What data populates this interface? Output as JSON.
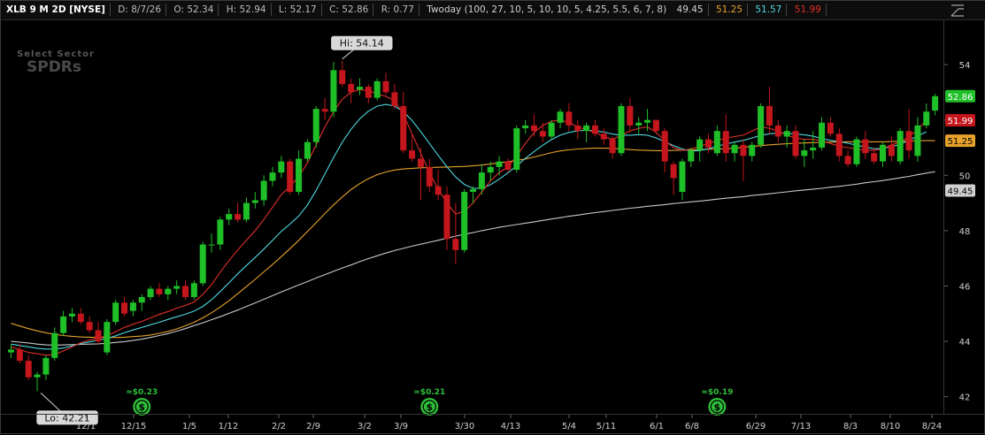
{
  "header": {
    "symbol": "XLB 9 M 2D [NYSE]",
    "date": "D: 8/7/26",
    "open": "O: 52.34",
    "high": "H: 52.94",
    "low": "L: 52.17",
    "close": "C: 52.86",
    "range": "R: 0.77",
    "study": "Twoday (100, 27, 10, 5, 10, 10, 5, 4.25, 5.5, 6, 7, 8)",
    "study_values": [
      {
        "text": "49.45",
        "color": "#d0d0d0"
      },
      {
        "text": "51.25",
        "color": "#e6a22b"
      },
      {
        "text": "51.57",
        "color": "#4fd6e0"
      },
      {
        "text": "51.99",
        "color": "#e0302a"
      }
    ]
  },
  "watermark": {
    "line1": "Select Sector",
    "line2": "SPDRs"
  },
  "colors": {
    "up": "#1fbf27",
    "down": "#c4161c",
    "ma_fast": "#e0302a",
    "ma_mid": "#4fd6e0",
    "ma_slow": "#e6a22b",
    "ma_long": "#c8c8c8",
    "dividend": "#2fbf3a"
  },
  "chart_data": {
    "type": "candlestick",
    "price_ticks": [
      42,
      44,
      46,
      48,
      50,
      52,
      54
    ],
    "date_ticks": [
      "12/1",
      "12/15",
      "1/5",
      "1/12",
      "2/2",
      "2/9",
      "3/2",
      "3/9",
      "3/30",
      "4/13",
      "5/4",
      "5/11",
      "6/1",
      "6/8",
      "6/29",
      "7/13",
      "8/3",
      "8/10",
      "8/24"
    ],
    "ylim": [
      41.35,
      55.6
    ],
    "price_labels": [
      {
        "text": "52.86",
        "value": 52.86,
        "bg": "#1fbf27",
        "fg": "#ffffff"
      },
      {
        "text": "51.99",
        "value": 51.99,
        "bg": "#c4161c",
        "fg": "#ffffff"
      },
      {
        "text": "51.25",
        "value": 51.25,
        "bg": "#e6a22b",
        "fg": "#000000"
      },
      {
        "text": "49.45",
        "value": 49.45,
        "bg": "#d0d0d0",
        "fg": "#000000"
      }
    ],
    "hi_label": "Hi: 54.14",
    "lo_label": "Lo: 42.21",
    "dividends": [
      {
        "text": "≈$0.23",
        "index": 15
      },
      {
        "text": "≈$0.21",
        "index": 48
      },
      {
        "text": "≈$0.19",
        "index": 81
      }
    ],
    "candles": [
      [
        43.6,
        43.9,
        43.4,
        43.7
      ],
      [
        43.7,
        43.9,
        43.2,
        43.3
      ],
      [
        43.3,
        43.5,
        42.6,
        42.7
      ],
      [
        42.7,
        42.9,
        42.2,
        42.8
      ],
      [
        42.8,
        43.5,
        42.6,
        43.4
      ],
      [
        43.4,
        44.5,
        43.3,
        44.3
      ],
      [
        44.3,
        45.1,
        44.2,
        44.9
      ],
      [
        44.9,
        45.2,
        44.7,
        45.0
      ],
      [
        45.0,
        45.2,
        44.6,
        44.7
      ],
      [
        44.7,
        44.9,
        44.3,
        44.4
      ],
      [
        44.4,
        44.7,
        43.9,
        44.0
      ],
      [
        43.6,
        44.8,
        43.5,
        44.7
      ],
      [
        44.7,
        45.5,
        44.6,
        45.4
      ],
      [
        45.4,
        45.6,
        44.9,
        45.0
      ],
      [
        45.1,
        45.5,
        44.9,
        45.4
      ],
      [
        45.4,
        45.7,
        45.1,
        45.6
      ],
      [
        45.6,
        46.0,
        45.5,
        45.9
      ],
      [
        45.9,
        46.1,
        45.6,
        45.7
      ],
      [
        45.7,
        46.0,
        45.5,
        45.9
      ],
      [
        45.9,
        46.2,
        45.7,
        46.0
      ],
      [
        46.0,
        46.2,
        45.5,
        45.6
      ],
      [
        45.6,
        46.2,
        45.5,
        46.1
      ],
      [
        46.1,
        47.6,
        46.0,
        47.5
      ],
      [
        47.5,
        47.9,
        47.2,
        47.5
      ],
      [
        47.5,
        48.5,
        47.3,
        48.4
      ],
      [
        48.4,
        48.8,
        48.2,
        48.6
      ],
      [
        48.6,
        49.0,
        48.3,
        48.4
      ],
      [
        48.4,
        49.2,
        48.3,
        49.0
      ],
      [
        49.0,
        49.4,
        48.8,
        49.1
      ],
      [
        49.1,
        50.0,
        48.9,
        49.8
      ],
      [
        49.8,
        50.3,
        49.6,
        50.1
      ],
      [
        50.1,
        50.7,
        49.9,
        50.5
      ],
      [
        50.5,
        50.6,
        49.3,
        49.4
      ],
      [
        49.4,
        50.9,
        49.3,
        50.6
      ],
      [
        50.6,
        51.3,
        50.5,
        51.2
      ],
      [
        51.2,
        52.5,
        51.0,
        52.4
      ],
      [
        52.4,
        52.8,
        52.0,
        52.3
      ],
      [
        52.3,
        54.1,
        52.1,
        53.8
      ],
      [
        53.8,
        54.14,
        53.2,
        53.3
      ],
      [
        53.3,
        53.5,
        52.6,
        53.0
      ],
      [
        53.1,
        53.5,
        52.9,
        53.2
      ],
      [
        53.2,
        53.3,
        52.6,
        52.8
      ],
      [
        52.8,
        53.5,
        52.7,
        53.4
      ],
      [
        53.4,
        53.7,
        52.9,
        53.0
      ],
      [
        53.0,
        53.3,
        52.4,
        52.5
      ],
      [
        52.5,
        53.0,
        50.8,
        50.9
      ],
      [
        50.9,
        51.5,
        50.5,
        50.6
      ],
      [
        50.6,
        51.0,
        49.1,
        50.3
      ],
      [
        50.3,
        50.6,
        49.4,
        49.6
      ],
      [
        49.6,
        50.2,
        49.1,
        49.3
      ],
      [
        49.3,
        49.6,
        47.3,
        47.7
      ],
      [
        47.7,
        49.0,
        46.8,
        47.3
      ],
      [
        47.3,
        49.5,
        47.2,
        49.4
      ],
      [
        49.4,
        49.6,
        49.0,
        49.5
      ],
      [
        49.5,
        50.4,
        49.3,
        50.1
      ],
      [
        50.1,
        50.5,
        49.8,
        50.3
      ],
      [
        50.3,
        50.7,
        50.0,
        50.5
      ],
      [
        50.5,
        50.6,
        50.1,
        50.2
      ],
      [
        50.2,
        51.8,
        50.1,
        51.7
      ],
      [
        51.7,
        52.0,
        51.5,
        51.8
      ],
      [
        51.8,
        52.2,
        51.4,
        51.6
      ],
      [
        51.6,
        51.9,
        51.2,
        51.4
      ],
      [
        51.4,
        52.0,
        51.3,
        51.9
      ],
      [
        51.9,
        52.4,
        51.7,
        52.3
      ],
      [
        52.3,
        52.6,
        51.6,
        51.8
      ],
      [
        51.8,
        52.0,
        51.3,
        51.6
      ],
      [
        51.6,
        51.9,
        51.2,
        51.8
      ],
      [
        51.8,
        52.0,
        51.4,
        51.5
      ],
      [
        51.5,
        51.7,
        51.1,
        51.3
      ],
      [
        51.3,
        51.4,
        50.6,
        50.8
      ],
      [
        50.8,
        52.6,
        50.7,
        52.5
      ],
      [
        52.5,
        52.8,
        51.6,
        51.8
      ],
      [
        51.8,
        52.1,
        51.5,
        51.9
      ],
      [
        51.9,
        52.4,
        51.6,
        52.0
      ],
      [
        52.0,
        51.9,
        51.5,
        51.6
      ],
      [
        51.6,
        51.7,
        50.1,
        50.5
      ],
      [
        50.4,
        50.5,
        49.3,
        49.9
      ],
      [
        49.4,
        50.6,
        49.1,
        50.5
      ],
      [
        50.5,
        51.0,
        50.3,
        50.9
      ],
      [
        50.9,
        51.4,
        50.5,
        51.3
      ],
      [
        51.3,
        51.5,
        50.8,
        51.0
      ],
      [
        50.8,
        51.8,
        50.7,
        51.6
      ],
      [
        51.6,
        52.2,
        50.5,
        50.8
      ],
      [
        50.8,
        51.2,
        50.5,
        51.1
      ],
      [
        51.1,
        51.3,
        49.8,
        50.7
      ],
      [
        50.7,
        51.2,
        50.5,
        51.1
      ],
      [
        51.1,
        52.6,
        51.0,
        52.5
      ],
      [
        52.5,
        53.2,
        51.5,
        51.8
      ],
      [
        51.8,
        52.0,
        51.2,
        51.4
      ],
      [
        51.4,
        51.8,
        51.0,
        51.6
      ],
      [
        51.6,
        51.8,
        50.6,
        50.7
      ],
      [
        50.7,
        51.3,
        50.3,
        50.9
      ],
      [
        50.9,
        51.6,
        50.6,
        51.0
      ],
      [
        51.0,
        52.1,
        50.9,
        51.9
      ],
      [
        51.9,
        52.1,
        51.4,
        51.5
      ],
      [
        51.5,
        51.7,
        50.5,
        50.7
      ],
      [
        50.7,
        50.9,
        50.3,
        50.4
      ],
      [
        50.4,
        51.4,
        50.3,
        51.3
      ],
      [
        51.3,
        51.6,
        50.6,
        50.8
      ],
      [
        50.8,
        51.0,
        50.4,
        50.5
      ],
      [
        50.5,
        51.2,
        50.3,
        51.1
      ],
      [
        51.1,
        51.4,
        50.5,
        50.7
      ],
      [
        50.5,
        51.7,
        50.4,
        51.6
      ],
      [
        51.6,
        52.4,
        50.6,
        50.9
      ],
      [
        50.7,
        52.1,
        50.5,
        51.8
      ],
      [
        51.8,
        52.6,
        51.7,
        52.3
      ],
      [
        52.34,
        52.94,
        52.17,
        52.86
      ]
    ],
    "series": [
      {
        "name": "49.45",
        "values": [
          44.0,
          43.97,
          43.94,
          43.9,
          43.87,
          43.86,
          43.87,
          43.88,
          43.89,
          43.9,
          43.91,
          43.93,
          43.96,
          43.99,
          44.03,
          44.08,
          44.14,
          44.21,
          44.28,
          44.37,
          44.46,
          44.57,
          44.67,
          44.78,
          44.89,
          45.01,
          45.13,
          45.26,
          45.39,
          45.52,
          45.65,
          45.78,
          45.91,
          46.04,
          46.16,
          46.29,
          46.41,
          46.53,
          46.65,
          46.76,
          46.88,
          46.99,
          47.09,
          47.19,
          47.28,
          47.36,
          47.44,
          47.51,
          47.58,
          47.65,
          47.73,
          47.8,
          47.87,
          47.93,
          48.0,
          48.06,
          48.12,
          48.17,
          48.22,
          48.27,
          48.32,
          48.37,
          48.42,
          48.47,
          48.52,
          48.56,
          48.61,
          48.65,
          48.69,
          48.73,
          48.77,
          48.81,
          48.84,
          48.88,
          48.91,
          48.94,
          48.98,
          49.01,
          49.04,
          49.07,
          49.1,
          49.14,
          49.17,
          49.2,
          49.23,
          49.27,
          49.3,
          49.33,
          49.37,
          49.4,
          49.44,
          49.47,
          49.5,
          49.53,
          49.57,
          49.6,
          49.64,
          49.68,
          49.73,
          49.77,
          49.81,
          49.86,
          49.91,
          49.96,
          50.02,
          50.08,
          50.13,
          49.45
        ]
      },
      {
        "name": "51.25",
        "values": [
          44.65,
          44.55,
          44.46,
          44.38,
          44.31,
          44.25,
          44.21,
          44.18,
          44.16,
          44.15,
          44.14,
          44.14,
          44.14,
          44.15,
          44.17,
          44.19,
          44.23,
          44.29,
          44.36,
          44.45,
          44.56,
          44.69,
          44.85,
          45.03,
          45.24,
          45.47,
          45.72,
          45.98,
          46.24,
          46.51,
          46.78,
          47.06,
          47.35,
          47.65,
          47.97,
          48.29,
          48.62,
          48.93,
          49.22,
          49.48,
          49.7,
          49.88,
          50.02,
          50.12,
          50.19,
          50.23,
          50.25,
          50.27,
          50.28,
          50.29,
          50.3,
          50.31,
          50.32,
          50.34,
          50.37,
          50.41,
          50.45,
          50.49,
          50.54,
          50.59,
          50.66,
          50.74,
          50.82,
          50.88,
          50.92,
          50.95,
          50.97,
          50.98,
          50.98,
          50.97,
          50.95,
          50.93,
          50.91,
          50.9,
          50.89,
          50.89,
          50.9,
          50.91,
          50.92,
          50.93,
          50.94,
          50.95,
          50.96,
          50.98,
          51.01,
          51.04,
          51.07,
          51.1,
          51.12,
          51.14,
          51.16,
          51.17,
          51.18,
          51.19,
          51.2,
          51.21,
          51.21,
          51.21,
          51.21,
          51.21,
          51.21,
          51.22,
          51.23,
          51.24,
          51.25,
          51.25,
          51.25,
          51.25
        ]
      },
      {
        "name": "51.57",
        "values": [
          43.9,
          43.85,
          43.8,
          43.75,
          43.72,
          43.72,
          43.76,
          43.84,
          43.92,
          43.98,
          44.04,
          44.1,
          44.2,
          44.31,
          44.41,
          44.5,
          44.6,
          44.69,
          44.79,
          44.89,
          44.98,
          45.09,
          45.26,
          45.5,
          45.8,
          46.12,
          46.44,
          46.74,
          47.03,
          47.33,
          47.65,
          47.97,
          48.24,
          48.53,
          48.93,
          49.46,
          50.05,
          50.64,
          51.2,
          51.66,
          52.04,
          52.32,
          52.5,
          52.56,
          52.5,
          52.3,
          51.98,
          51.58,
          51.15,
          50.72,
          50.31,
          49.94,
          49.67,
          49.53,
          49.53,
          49.66,
          49.86,
          50.09,
          50.34,
          50.61,
          50.86,
          51.09,
          51.29,
          51.45,
          51.55,
          51.61,
          51.63,
          51.61,
          51.56,
          51.49,
          51.45,
          51.45,
          51.47,
          51.45,
          51.35,
          51.21,
          51.07,
          50.95,
          50.88,
          50.89,
          50.96,
          51.05,
          51.13,
          51.2,
          51.26,
          51.35,
          51.44,
          51.5,
          51.53,
          51.52,
          51.49,
          51.46,
          51.41,
          51.33,
          51.26,
          51.22,
          51.16,
          51.09,
          51.02,
          50.96,
          50.97,
          51.03,
          51.12,
          51.26,
          51.42,
          51.57
        ]
      },
      {
        "name": "51.99",
        "values": [
          43.8,
          43.7,
          43.6,
          43.55,
          43.5,
          43.52,
          43.65,
          43.8,
          43.95,
          44.05,
          44.12,
          44.2,
          44.35,
          44.5,
          44.62,
          44.72,
          44.85,
          44.97,
          45.08,
          45.2,
          45.3,
          45.42,
          45.7,
          46.05,
          46.5,
          46.92,
          47.3,
          47.65,
          48.0,
          48.4,
          48.85,
          49.3,
          49.6,
          49.95,
          50.45,
          51.1,
          51.75,
          52.3,
          52.75,
          53.0,
          53.1,
          53.05,
          52.95,
          52.85,
          52.7,
          52.2,
          51.5,
          50.8,
          50.1,
          49.5,
          49.0,
          48.6,
          48.7,
          49.0,
          49.4,
          49.8,
          50.1,
          50.3,
          50.7,
          51.15,
          51.55,
          51.8,
          51.95,
          52.0,
          51.9,
          51.75,
          51.65,
          51.55,
          51.4,
          51.3,
          51.45,
          51.6,
          51.7,
          51.75,
          51.55,
          51.25,
          51.0,
          50.9,
          50.95,
          51.05,
          51.15,
          51.25,
          51.35,
          51.4,
          51.45,
          51.6,
          51.75,
          51.7,
          51.6,
          51.45,
          51.35,
          51.3,
          51.3,
          51.25,
          51.15,
          51.05,
          51.0,
          50.95,
          50.9,
          50.9,
          50.95,
          51.1,
          51.2,
          51.4,
          51.65,
          51.99
        ]
      }
    ]
  }
}
